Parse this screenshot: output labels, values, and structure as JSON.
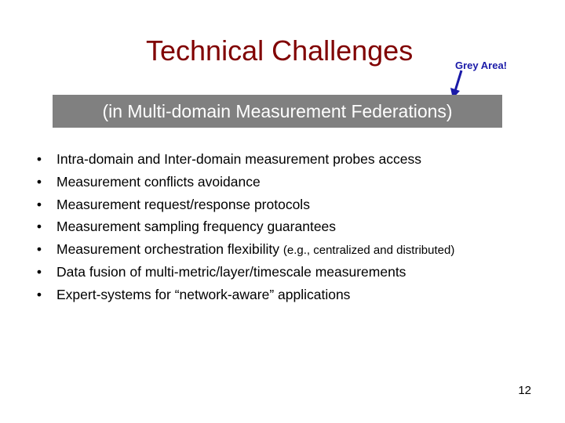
{
  "slide": {
    "title": "Technical Challenges",
    "callout": "Grey Area!",
    "subtitle": "(in Multi-domain Measurement Federations)",
    "bullet_glyph": "•",
    "bullets": [
      {
        "text": "Intra-domain and Inter-domain measurement probes access",
        "note": ""
      },
      {
        "text": "Measurement conflicts avoidance",
        "note": ""
      },
      {
        "text": "Measurement request/response protocols",
        "note": ""
      },
      {
        "text": "Measurement sampling frequency guarantees",
        "note": ""
      },
      {
        "text": "Measurement orchestration flexibility ",
        "note": "(e.g., centralized and distributed)"
      },
      {
        "text": "Data fusion of multi-metric/layer/timescale measurements",
        "note": ""
      },
      {
        "text": "Expert-systems for “network-aware” applications",
        "note": ""
      }
    ],
    "page_number": "12",
    "colors": {
      "title": "#800000",
      "callout": "#1a1aa8",
      "subtitle_bar": "#808080"
    }
  }
}
